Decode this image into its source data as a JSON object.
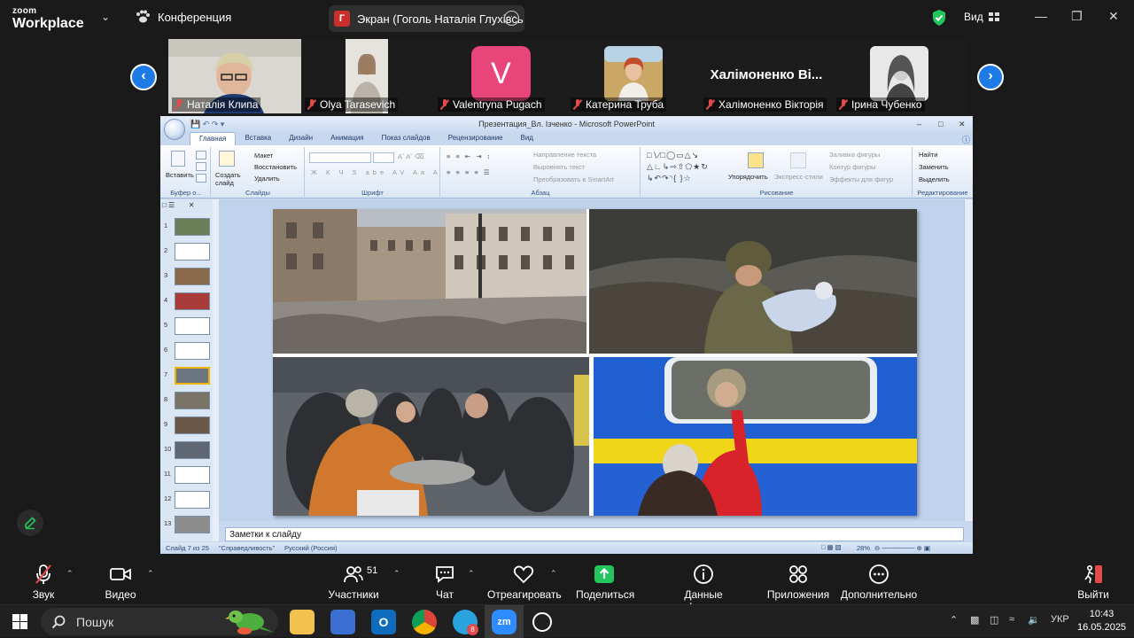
{
  "zoom": {
    "logo_line1": "zoom",
    "logo_line2": "Workplace",
    "meeting_label": "Конференция",
    "screen_share_label": "Экран (Гоголь Наталія Глухівсь",
    "screen_share_initial": "Г",
    "view_label": "Вид"
  },
  "participants": [
    {
      "name": "Наталія Клипа",
      "video": "photo"
    },
    {
      "name": "Olya Tarasevich",
      "video": "photo"
    },
    {
      "name": "Valentryna Pugach",
      "video": "avatar",
      "initial": "V",
      "avatar_color": "#e8457a"
    },
    {
      "name": "Катерина Труба",
      "video": "photo"
    },
    {
      "name": "Халімоненко Вікторія",
      "video": "name",
      "display_name": "Халімоненко Ві..."
    },
    {
      "name": "Ірина Чубенко",
      "video": "photo"
    }
  ],
  "ppt": {
    "window_title": "Презентация_Вл. Ізченко - Microsoft PowerPoint",
    "tabs": [
      "Главная",
      "Вставка",
      "Дизайн",
      "Анимация",
      "Показ слайдов",
      "Рецензирование",
      "Вид"
    ],
    "ribbon": {
      "paste": "Вставить",
      "clipboard_group": "Буфер о...",
      "layout": "Макет",
      "reset": "Восстановить",
      "new_slide": "Создать слайд",
      "delete": "Удалить",
      "slides_group": "Слайды",
      "font_group": "Шрифт",
      "text_direction": "Направление текста",
      "align_text": "Выровнять текст",
      "smartart": "Преобразовать в SmartArt",
      "paragraph_group": "Абзац",
      "arrange": "Упорядочить",
      "quick_styles": "Экспресс-стили",
      "shape_fill": "Заливка фигуры",
      "shape_outline": "Контур фигуры",
      "shape_effects": "Эффекты для фигур",
      "drawing_group": "Рисование",
      "find": "Найти",
      "replace": "Заменить",
      "select": "Выделить",
      "editing_group": "Редактирование"
    },
    "slide_numbers": [
      "1",
      "2",
      "3",
      "4",
      "5",
      "6",
      "7",
      "8",
      "9",
      "10",
      "11",
      "12",
      "13"
    ],
    "notes_placeholder": "Заметки к слайду",
    "status": {
      "slide_info": "Слайд 7 из 25",
      "theme": "\"Справедливость\"",
      "language": "Русский (Россия)",
      "zoom": "28%"
    }
  },
  "toolbar": {
    "audio": "Звук",
    "video": "Видео",
    "participants": "Участники",
    "participants_count": "51",
    "chat": "Чат",
    "react": "Отреагировать",
    "share": "Поделиться",
    "meeting_info": "Данные конференции",
    "apps": "Приложения",
    "more": "Дополнительно",
    "leave": "Выйти"
  },
  "taskbar": {
    "search_placeholder": "Пошук",
    "telegram_badge": "8",
    "language": "УКР",
    "time": "10:43",
    "date": "16.05.2025"
  },
  "colors": {
    "zoom_blue": "#1e7ae6",
    "mic_off_red": "#e24b4b",
    "share_green": "#22c55e",
    "ppt_ribbon": "#dce7f5"
  }
}
